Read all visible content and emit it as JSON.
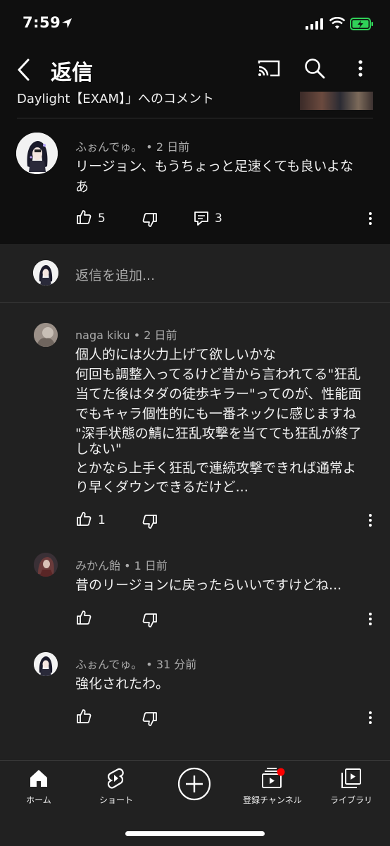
{
  "status_bar": {
    "time": "7:59"
  },
  "header": {
    "title": "返信"
  },
  "parent": {
    "video_title": "Daylight【EXAM】」へのコメント",
    "author": "ふぉんでゅ。",
    "age": "2 日前",
    "text_line1": "リージョン、もうちょっと足速くても良いよな",
    "text_line2": "あ",
    "likes": "5",
    "replies": "3"
  },
  "add_reply": {
    "placeholder": "返信を追加..."
  },
  "comments": [
    {
      "author": "naga kiku",
      "age": "2 日前",
      "lines": [
        "個人的には火力上げて欲しいかな",
        "何回も調整入ってるけど昔から言われてる\"狂乱",
        "当てた後はタダの徒歩キラー\"ってのが、性能面",
        "でもキャラ個性的にも一番ネックに感じますね",
        "\"深手状態の鯖に狂乱攻撃を当てても狂乱が終了",
        "しない\"",
        "とかなら上手く狂乱で連続攻撃できれば通常よ",
        "り早くダウンできるだけど..."
      ],
      "likes": "1"
    },
    {
      "author": "みかん飴",
      "age": "1 日前",
      "lines": [
        "昔のリージョンに戻ったらいいですけどね..."
      ],
      "likes": ""
    },
    {
      "author": "ふぉんでゅ。",
      "age": "31 分前",
      "lines": [
        "強化されたわ。"
      ],
      "likes": ""
    }
  ],
  "nav": {
    "home": "ホーム",
    "shorts": "ショート",
    "subscriptions": "登録チャンネル",
    "library": "ライブラリ"
  },
  "colors": {
    "background": "#212121",
    "header_bg": "#0f0f0f",
    "meta_text": "#aaaaaa",
    "notification_dot": "#ff0000",
    "battery": "#30d158"
  }
}
